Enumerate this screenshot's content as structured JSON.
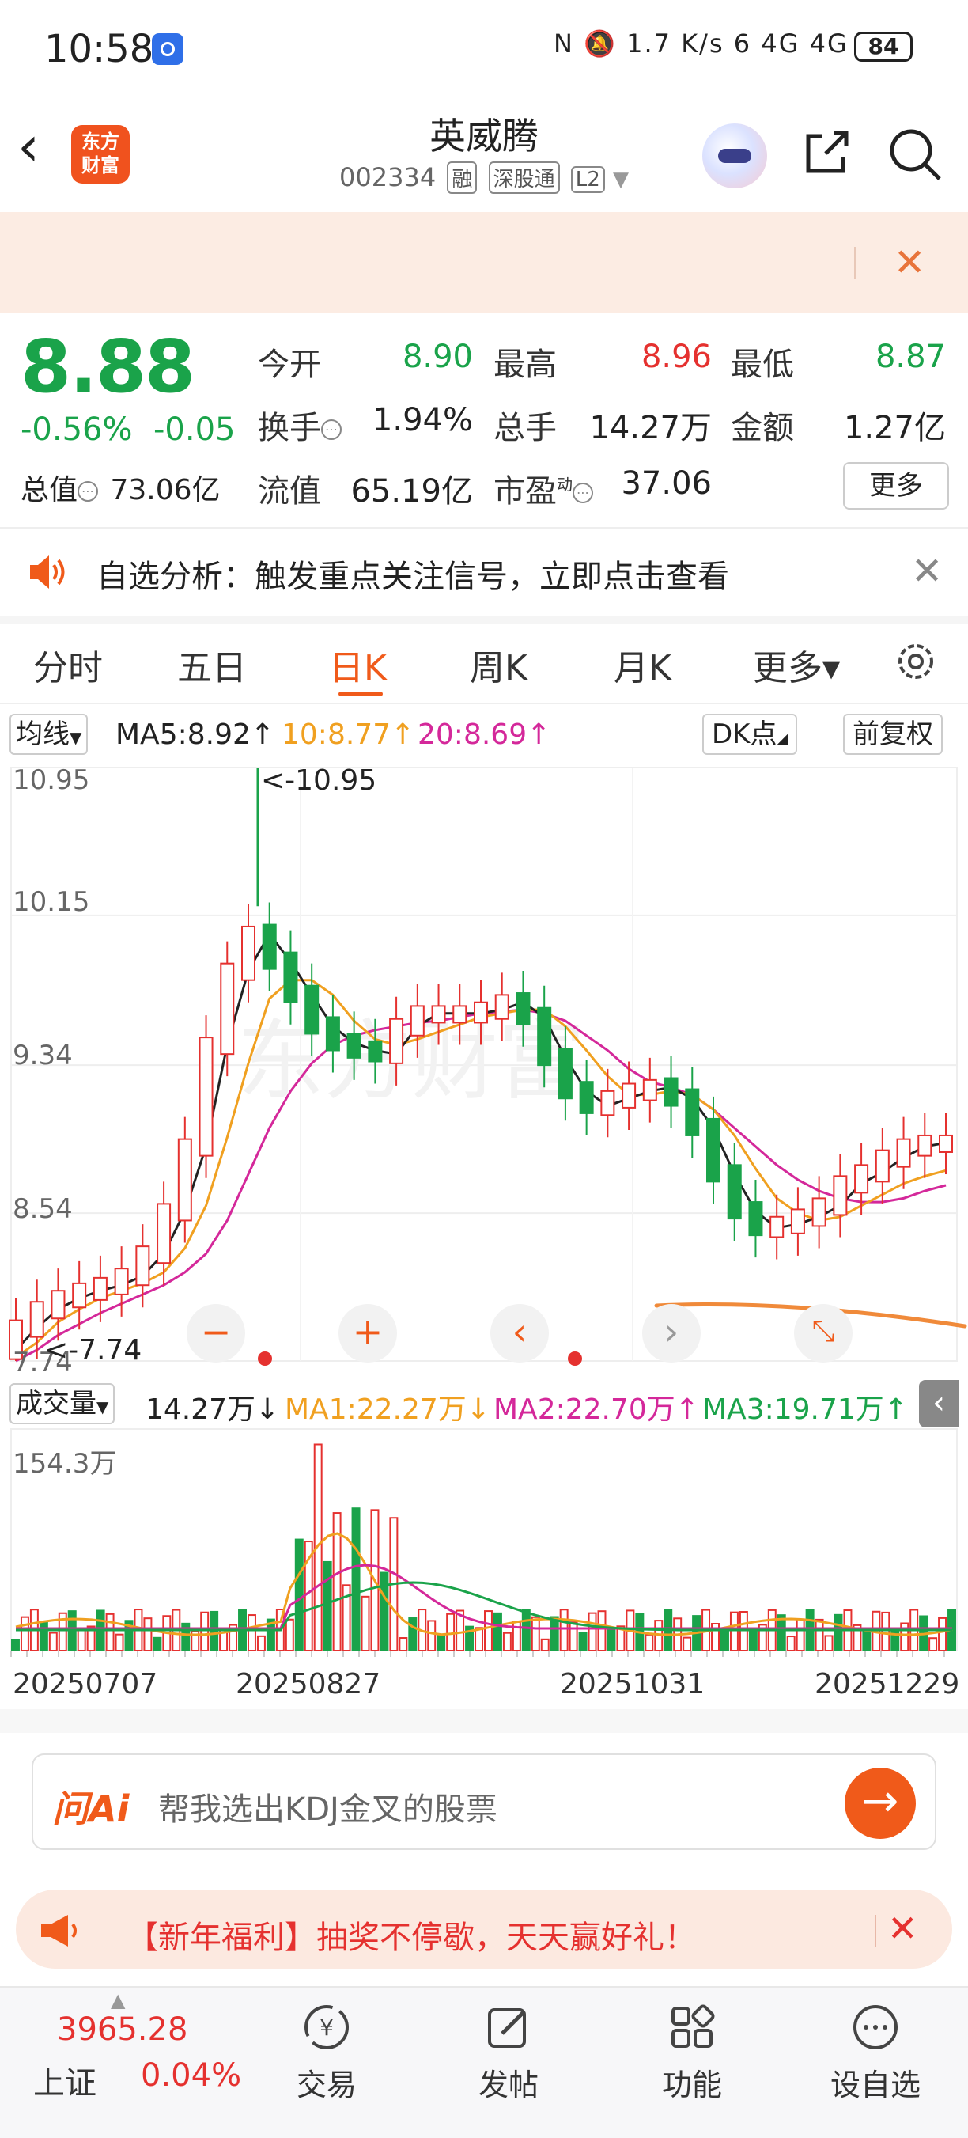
{
  "status_bar": {
    "time": "10:58",
    "icons": "N  🔕  1.7 K/s  6  4G  4G",
    "battery": "84"
  },
  "header": {
    "title": "英威腾",
    "code": "002334",
    "tags": [
      "融",
      "深股通",
      "L2"
    ]
  },
  "quote": {
    "price": "8.88",
    "change_pct": "-0.56%",
    "change": "-0.05",
    "fields": [
      {
        "label": "今开",
        "value": "8.90",
        "color": "green"
      },
      {
        "label": "最高",
        "value": "8.96",
        "color": "red"
      },
      {
        "label": "最低",
        "value": "8.87",
        "color": "green"
      },
      {
        "label": "换手",
        "value": "1.94%",
        "color": "dark"
      },
      {
        "label": "总手",
        "value": "14.27万",
        "color": "dark"
      },
      {
        "label": "金额",
        "value": "1.27亿",
        "color": "dark"
      },
      {
        "label": "流值",
        "value": "65.19亿",
        "color": "dark"
      },
      {
        "label": "市盈",
        "value": "37.06",
        "color": "dark"
      }
    ],
    "total_value_label": "总值",
    "total_value": "73.06亿",
    "pe_superscript": "动",
    "more_label": "更多"
  },
  "notice": {
    "text": "自选分析：触发重点关注信号，立即点击查看"
  },
  "tabs": [
    {
      "label": "分时",
      "active": false
    },
    {
      "label": "五日",
      "active": false
    },
    {
      "label": "日K",
      "active": true
    },
    {
      "label": "周K",
      "active": false
    },
    {
      "label": "月K",
      "active": false
    },
    {
      "label": "更多▾",
      "active": false
    }
  ],
  "ma_bar": {
    "dropdown": "均线",
    "ma5": "MA5:8.92↑",
    "ma10": "10:8.77↑",
    "ma20": "20:8.69↑",
    "dk": "DK点",
    "adjust": "前复权",
    "colors": {
      "ma5": "#222222",
      "ma10": "#f0a020",
      "ma20": "#d4289a"
    }
  },
  "chart_data": [
    {
      "type": "candlestick",
      "y_labels": [
        "10.95",
        "10.15",
        "9.34",
        "8.54",
        "7.74"
      ],
      "ylim": [
        7.74,
        10.95
      ],
      "annotations": [
        "<-10.95",
        "<-7.74"
      ],
      "ma5": [
        7.8,
        7.92,
        8.02,
        8.08,
        8.12,
        8.15,
        8.2,
        8.32,
        8.55,
        8.9,
        9.45,
        9.85,
        10.05,
        9.9,
        9.72,
        9.55,
        9.46,
        9.42,
        9.4,
        9.55,
        9.62,
        9.62,
        9.62,
        9.64,
        9.68,
        9.6,
        9.38,
        9.2,
        9.12,
        9.16,
        9.2,
        9.22,
        9.16,
        9.0,
        8.75,
        8.55,
        8.46,
        8.48,
        8.52,
        8.58,
        8.7,
        8.76,
        8.84,
        8.9,
        8.92
      ],
      "ma10": [
        7.76,
        7.84,
        7.95,
        8.02,
        8.08,
        8.12,
        8.16,
        8.22,
        8.35,
        8.58,
        8.95,
        9.35,
        9.7,
        9.8,
        9.8,
        9.72,
        9.58,
        9.48,
        9.45,
        9.48,
        9.52,
        9.56,
        9.6,
        9.62,
        9.64,
        9.64,
        9.55,
        9.42,
        9.28,
        9.18,
        9.18,
        9.2,
        9.18,
        9.1,
        8.96,
        8.78,
        8.62,
        8.54,
        8.5,
        8.52,
        8.58,
        8.64,
        8.7,
        8.74,
        8.77
      ],
      "ma20": [
        7.74,
        7.8,
        7.88,
        7.94,
        8.0,
        8.05,
        8.1,
        8.15,
        8.22,
        8.32,
        8.5,
        8.75,
        9.0,
        9.2,
        9.35,
        9.45,
        9.5,
        9.53,
        9.55,
        9.57,
        9.58,
        9.6,
        9.62,
        9.63,
        9.64,
        9.62,
        9.58,
        9.5,
        9.42,
        9.32,
        9.25,
        9.22,
        9.18,
        9.1,
        9.0,
        8.9,
        8.8,
        8.72,
        8.66,
        8.62,
        8.6,
        8.6,
        8.62,
        8.66,
        8.69
      ]
    },
    {
      "type": "bar",
      "title": "成交量",
      "y_labels": [
        "154.3万"
      ],
      "dates": [
        "20250707",
        "20250827",
        "20251031",
        "20251229"
      ]
    }
  ],
  "vol_bar": {
    "dropdown": "成交量",
    "vol": "14.27万↓",
    "ma1": "MA1:22.27万↓",
    "ma2": "MA2:22.70万↑",
    "ma3": "MA3:19.71万↑",
    "colors": {
      "ma1": "#f0a020",
      "ma2": "#d4289a",
      "ma3": "#1aa34a"
    }
  },
  "ask_ai": {
    "logo": "问Ai",
    "placeholder": "帮我选出KDJ金叉的股票"
  },
  "promo": {
    "text": "【新年福利】抽奖不停歇，天天赢好礼！"
  },
  "bottom_nav": {
    "index_value": "3965.28",
    "index_name": "上证",
    "index_pct": "0.04%",
    "items": [
      {
        "label": "交易",
        "icon": "trade-icon"
      },
      {
        "label": "发帖",
        "icon": "post-icon"
      },
      {
        "label": "功能",
        "icon": "features-icon"
      },
      {
        "label": "设自选",
        "icon": "add-watchlist-icon"
      }
    ]
  }
}
